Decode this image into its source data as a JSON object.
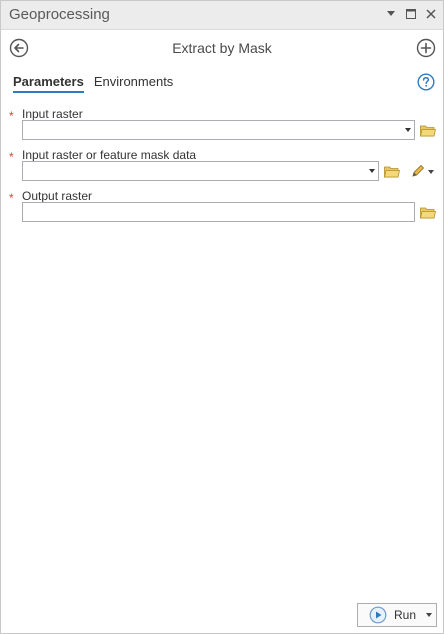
{
  "window": {
    "title": "Geoprocessing"
  },
  "tool": {
    "title": "Extract by Mask"
  },
  "tabs": [
    {
      "label": "Parameters",
      "active": true
    },
    {
      "label": "Environments",
      "active": false
    }
  ],
  "params": [
    {
      "label": "Input raster",
      "required": true,
      "value": "",
      "type": "dropdown-with-browse"
    },
    {
      "label": "Input raster or feature mask data",
      "required": true,
      "value": "",
      "type": "dropdown-with-browse-and-sketch"
    },
    {
      "label": "Output raster",
      "required": true,
      "value": "",
      "type": "text-with-browse"
    }
  ],
  "required_marker": "*",
  "run_button": {
    "label": "Run"
  },
  "icons": {
    "back": "back-arrow-circle-icon",
    "add": "plus-circle-icon",
    "help": "help-circle-icon",
    "browse": "folder-icon",
    "sketch": "pencil-icon",
    "run": "play-circle-icon"
  },
  "colors": {
    "accent": "#2c7cc2",
    "required": "#d1462f",
    "folder": "#e2b94a"
  }
}
